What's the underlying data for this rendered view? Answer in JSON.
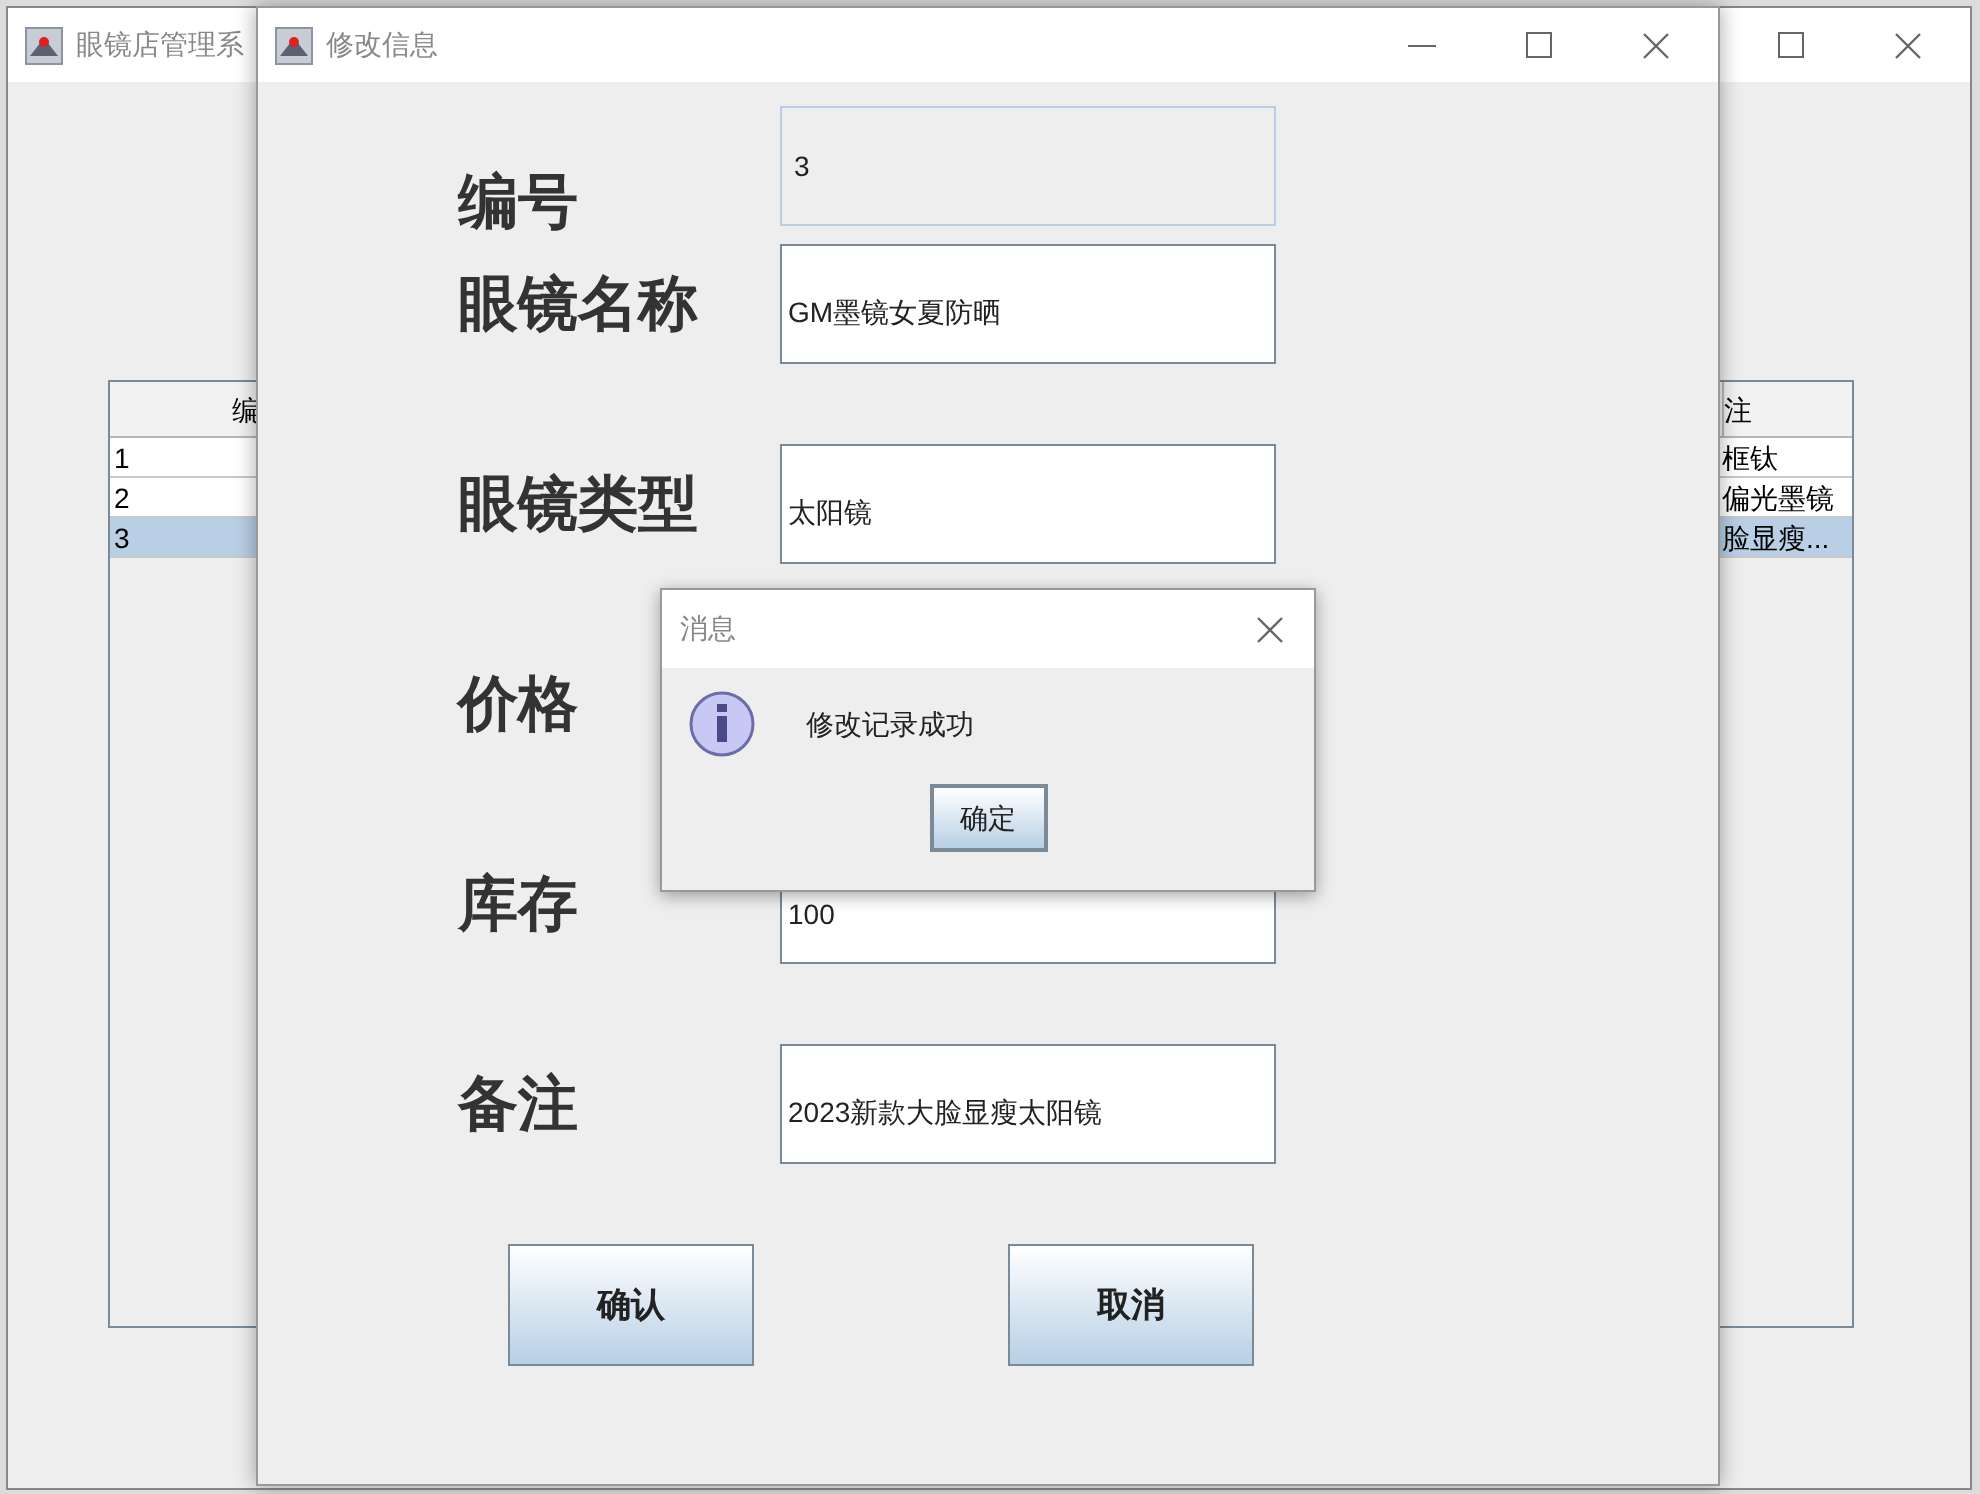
{
  "main_window": {
    "title": "眼镜店管理系",
    "table": {
      "columns": [
        "编",
        "注"
      ],
      "rows": [
        {
          "cells": [
            "1",
            "框钛"
          ],
          "selected": false
        },
        {
          "cells": [
            "2",
            "偏光墨镜"
          ],
          "selected": false
        },
        {
          "cells": [
            "3",
            "脸显瘦..."
          ],
          "selected": true
        }
      ]
    }
  },
  "edit_dialog": {
    "title": "修改信息",
    "fields": [
      {
        "label": "编号",
        "value": "3",
        "disabled": true
      },
      {
        "label": "眼镜名称",
        "value": "GM墨镜女夏防晒",
        "disabled": false
      },
      {
        "label": "眼镜类型",
        "value": "太阳镜",
        "disabled": false
      },
      {
        "label": "价格"
      },
      {
        "label": "库存",
        "value": "100",
        "disabled": false
      },
      {
        "label": "备注",
        "value": "2023新款大脸显瘦太阳镜",
        "disabled": false
      }
    ],
    "buttons": [
      "确认",
      "取消"
    ]
  },
  "message_box": {
    "title": "消息",
    "text": "修改记录成功",
    "button": "确定"
  }
}
